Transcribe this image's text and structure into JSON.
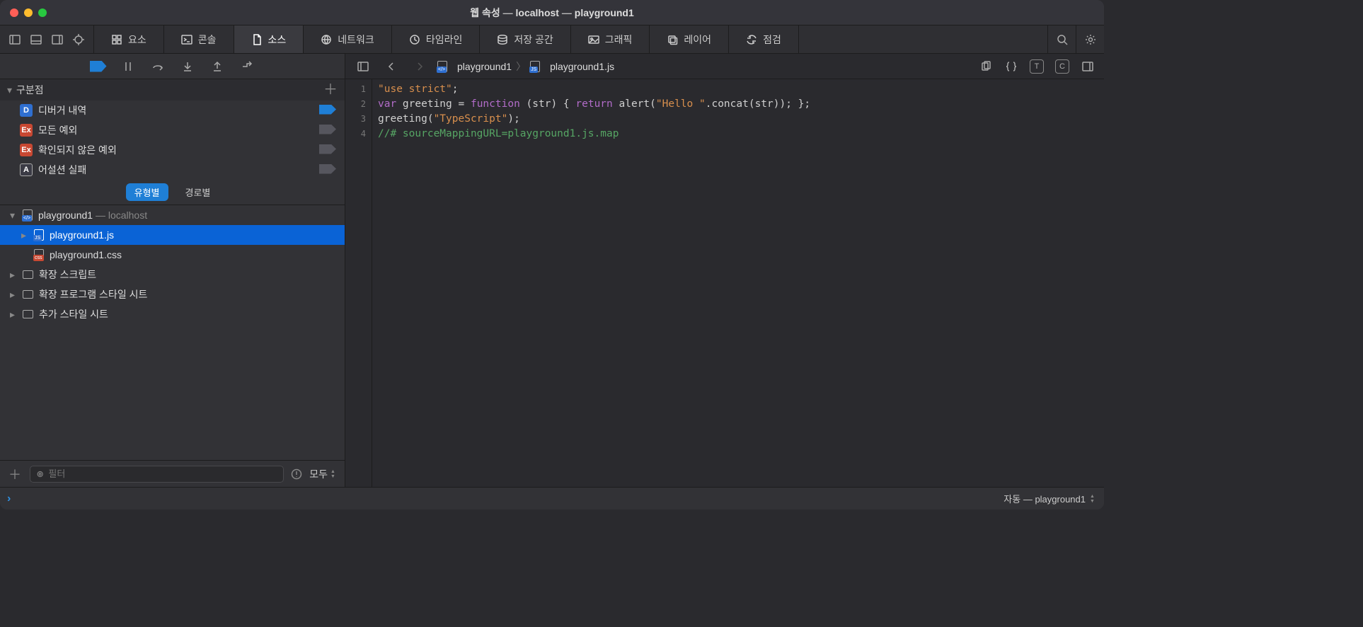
{
  "window": {
    "title_prefix": "웹 속성",
    "title_sep": " — ",
    "host": "localhost",
    "project": "playground1"
  },
  "tabs": [
    {
      "id": "elements",
      "label": "요소",
      "active": false
    },
    {
      "id": "console",
      "label": "콘솔",
      "active": false
    },
    {
      "id": "sources",
      "label": "소스",
      "active": true
    },
    {
      "id": "network",
      "label": "네트워크",
      "active": false
    },
    {
      "id": "timeline",
      "label": "타임라인",
      "active": false
    },
    {
      "id": "storage",
      "label": "저장 공간",
      "active": false
    },
    {
      "id": "graphics",
      "label": "그래픽",
      "active": false
    },
    {
      "id": "layers",
      "label": "레이어",
      "active": false
    },
    {
      "id": "audit",
      "label": "점검",
      "active": false
    }
  ],
  "sidebar": {
    "breakpoints": {
      "title": "구분점",
      "items": [
        {
          "icon": "D",
          "label": "디버거 내역",
          "active": true
        },
        {
          "icon": "Ex",
          "label": "모든 예외",
          "active": false
        },
        {
          "icon": "Ex",
          "label": "확인되지 않은 예외",
          "active": false
        },
        {
          "icon": "A",
          "label": "어설션 실패",
          "active": false
        }
      ]
    },
    "scope": {
      "byType": "유형별",
      "byPath": "경로별"
    },
    "tree": {
      "root": {
        "name": "playground1",
        "host": "localhost"
      },
      "files": [
        {
          "name": "playground1.js",
          "kind": "js",
          "selected": true
        },
        {
          "name": "playground1.css",
          "kind": "css",
          "selected": false
        }
      ],
      "folders": [
        {
          "name": "확장 스크립트"
        },
        {
          "name": "확장 프로그램 스타일 시트"
        },
        {
          "name": "추가 스타일 시트"
        }
      ]
    },
    "footer": {
      "filterPlaceholder": "필터",
      "scopeLabel": "모두"
    }
  },
  "editor": {
    "breadcrumb": {
      "root": "playground1",
      "file": "playground1.js"
    },
    "lines": [
      {
        "n": 1,
        "tokens": [
          {
            "t": "\"use strict\"",
            "c": "tok-str"
          },
          {
            "t": ";",
            "c": ""
          }
        ]
      },
      {
        "n": 2,
        "tokens": [
          {
            "t": "var",
            "c": "tok-kw"
          },
          {
            "t": " greeting = ",
            "c": ""
          },
          {
            "t": "function",
            "c": "tok-kw"
          },
          {
            "t": " (str) { ",
            "c": ""
          },
          {
            "t": "return",
            "c": "tok-kw"
          },
          {
            "t": " alert(",
            "c": ""
          },
          {
            "t": "\"Hello \"",
            "c": "tok-str"
          },
          {
            "t": ".concat(str)); };",
            "c": ""
          }
        ]
      },
      {
        "n": 3,
        "tokens": [
          {
            "t": "greeting(",
            "c": ""
          },
          {
            "t": "\"TypeScript\"",
            "c": "tok-str"
          },
          {
            "t": ");",
            "c": ""
          }
        ]
      },
      {
        "n": 4,
        "tokens": [
          {
            "t": "//# sourceMappingURL=playground1.js.map",
            "c": "tok-comment"
          }
        ]
      }
    ]
  },
  "console": {
    "context": "자동 — playground1"
  }
}
